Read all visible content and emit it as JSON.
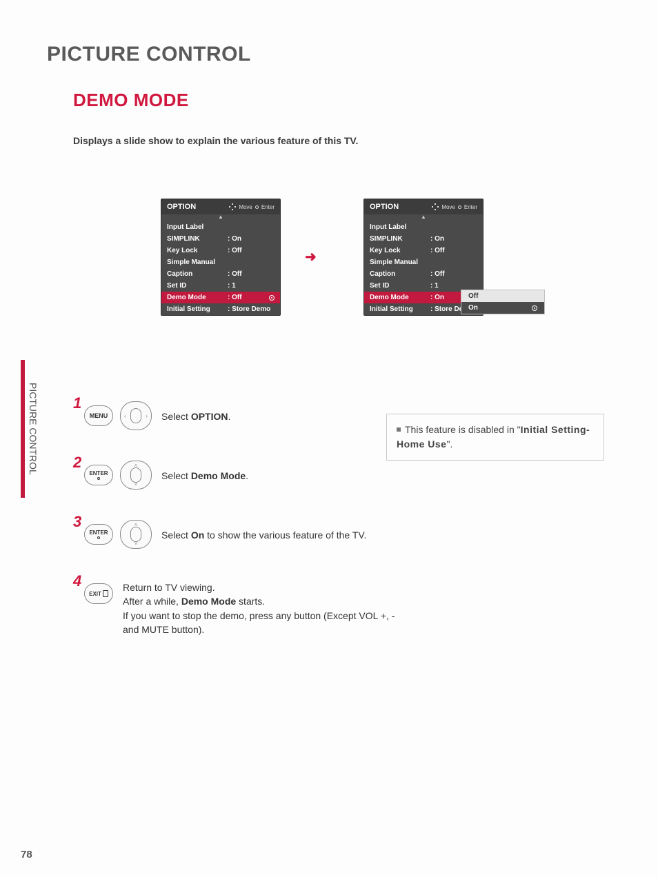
{
  "page_number": "78",
  "side_tab": "PICTURE CONTROL",
  "page_title": "PICTURE CONTROL",
  "section_title": "DEMO MODE",
  "intro": "Displays a slide show to explain the various feature of this TV.",
  "arrow": "➜",
  "osd_header": {
    "title": "OPTION",
    "hint_move": "Move",
    "hint_enter": "Enter",
    "up": "▲"
  },
  "osd_left_rows": [
    {
      "label": "Input Label",
      "value": "",
      "hl": false
    },
    {
      "label": "SIMPLINK",
      "value": ": On",
      "hl": false
    },
    {
      "label": "Key Lock",
      "value": ": Off",
      "hl": false
    },
    {
      "label": "Simple Manual",
      "value": "",
      "hl": false
    },
    {
      "label": "Caption",
      "value": ": Off",
      "hl": false
    },
    {
      "label": "Set ID",
      "value": ": 1",
      "hl": false
    },
    {
      "label": "Demo Mode",
      "value": ": Off",
      "hl": true,
      "ring": true
    },
    {
      "label": "Initial Setting",
      "value": ": Store Demo",
      "hl": false
    }
  ],
  "osd_right_rows": [
    {
      "label": "Input Label",
      "value": "",
      "hl": false
    },
    {
      "label": "SIMPLINK",
      "value": ": On",
      "hl": false
    },
    {
      "label": "Key Lock",
      "value": ": Off",
      "hl": false
    },
    {
      "label": "Simple Manual",
      "value": "",
      "hl": false
    },
    {
      "label": "Caption",
      "value": ": Off",
      "hl": false
    },
    {
      "label": "Set ID",
      "value": ": 1",
      "hl": false
    },
    {
      "label": "Demo Mode",
      "value": ": On",
      "hl": true
    },
    {
      "label": "Initial Setting",
      "value": ": Store Demo",
      "hl": false
    }
  ],
  "popup": {
    "off": "Off",
    "on": "On"
  },
  "buttons": {
    "menu": "MENU",
    "enter": "ENTER",
    "exit": "EXIT"
  },
  "steps": {
    "s1": {
      "num": "1",
      "pre": "Select ",
      "bold": "OPTION",
      "post": "."
    },
    "s2": {
      "num": "2",
      "pre": "Select ",
      "bold": "Demo Mode",
      "post": "."
    },
    "s3": {
      "num": "3",
      "pre": "Select ",
      "bold": "On",
      "post": " to show the various feature of the TV."
    },
    "s4": {
      "num": "4",
      "l1": "Return to TV viewing.",
      "l2_pre": "After a while, ",
      "l2_bold": "Demo Mode",
      "l2_post": " starts.",
      "l3": "If you want to stop the demo, press any button (Except VOL +, - and MUTE button)."
    }
  },
  "note": {
    "pre": "This feature is disabled in \"",
    "bold": "Initial Setting-Home Use",
    "post": "\"."
  }
}
